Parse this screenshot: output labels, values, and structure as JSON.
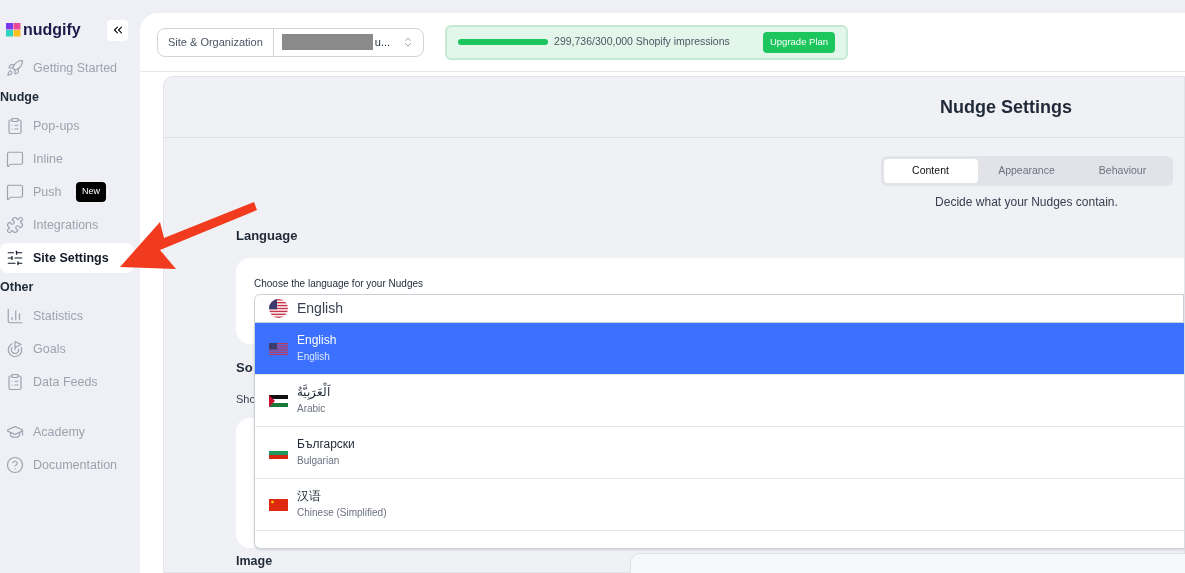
{
  "sidebar": {
    "logo": "nudgify",
    "sections": [
      {
        "items": [
          {
            "label": "Getting Started",
            "selected": false
          }
        ]
      },
      {
        "title": "Nudge",
        "items": [
          {
            "label": "Pop-ups",
            "selected": false
          },
          {
            "label": "Inline",
            "selected": false
          },
          {
            "label": "Push",
            "selected": false,
            "badge": "New"
          },
          {
            "label": "Integrations",
            "selected": false
          },
          {
            "label": "Site Settings",
            "selected": true
          }
        ]
      },
      {
        "title": "Other",
        "items": [
          {
            "label": "Statistics",
            "selected": false
          },
          {
            "label": "Goals",
            "selected": false
          },
          {
            "label": "Data Feeds",
            "selected": false
          }
        ]
      },
      {
        "items": [
          {
            "label": "Academy",
            "selected": false
          },
          {
            "label": "Documentation",
            "selected": false
          }
        ]
      }
    ]
  },
  "header": {
    "site_selector": {
      "label": "Site & Organization",
      "value": "u..."
    },
    "usage": {
      "level": 0.999,
      "text": "299,736/300,000 Shopify impressions",
      "button": "Upgrade Plan"
    }
  },
  "page": {
    "title": "Nudge Settings",
    "tabs": [
      {
        "label": "Content",
        "selected": true
      },
      {
        "label": "Appearance",
        "selected": false
      },
      {
        "label": "Behaviour",
        "selected": false
      }
    ],
    "tab_description": "Decide what your Nudges contain.",
    "language": {
      "heading": "Language",
      "label": "Choose the language for your Nudges",
      "selected": {
        "label": "English",
        "kind": "us"
      },
      "options": [
        {
          "label": "English",
          "subtitle": "English",
          "kind": "us",
          "selected": true
        },
        {
          "label": "اَلْعَرَبِيَّةُ",
          "subtitle": "Arabic",
          "kind": "ps",
          "selected": false
        },
        {
          "label": "Български",
          "subtitle": "Bulgarian",
          "kind": "bg",
          "selected": false
        },
        {
          "label": "汉语",
          "subtitle": "Chinese (Simplified)",
          "kind": "cn",
          "selected": false
        }
      ]
    },
    "heading_2": "So",
    "text_2": "Sho",
    "heading_3": "Image"
  }
}
